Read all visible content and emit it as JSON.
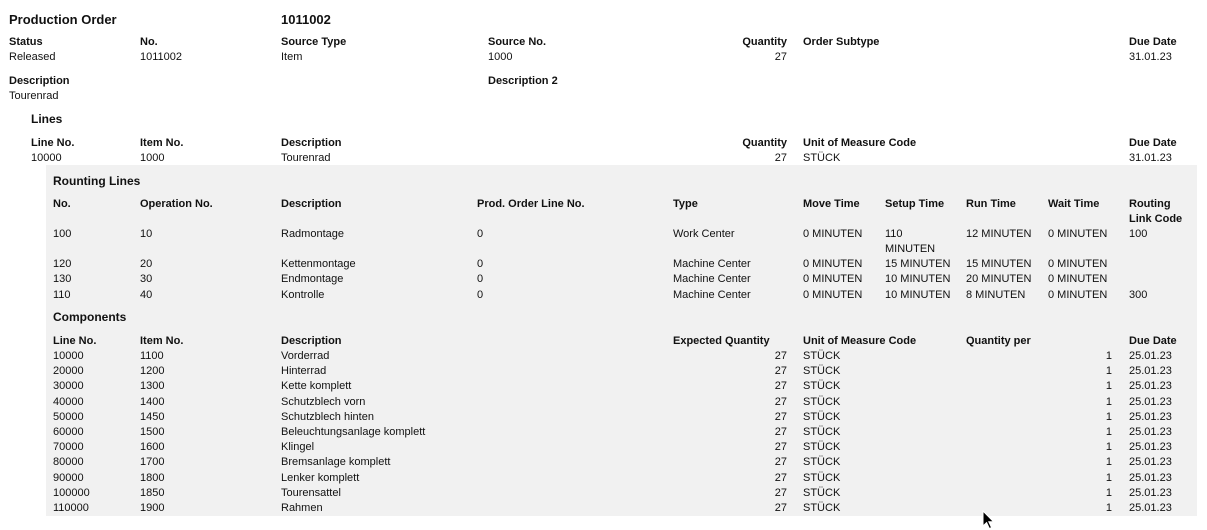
{
  "header": {
    "title": "Production Order",
    "number": "1011002",
    "fields": {
      "status": {
        "label": "Status",
        "value": "Released"
      },
      "no": {
        "label": "No.",
        "value": "1011002"
      },
      "source_type": {
        "label": "Source Type",
        "value": "Item"
      },
      "source_no": {
        "label": "Source No.",
        "value": "1000"
      },
      "quantity": {
        "label": "Quantity",
        "value": "27"
      },
      "order_subtype": {
        "label": "Order Subtype",
        "value": ""
      },
      "due_date": {
        "label": "Due Date",
        "value": "31.01.23"
      },
      "description": {
        "label": "Description",
        "value": "Tourenrad"
      },
      "description2": {
        "label": "Description 2",
        "value": ""
      }
    }
  },
  "lines": {
    "title": "Lines",
    "columns": {
      "line_no": "Line No.",
      "item_no": "Item No.",
      "description": "Description",
      "quantity": "Quantity",
      "uom": "Unit of Measure Code",
      "due_date": "Due Date"
    },
    "row": {
      "line_no": "10000",
      "item_no": "1000",
      "description": "Tourenrad",
      "quantity": "27",
      "uom": "STÜCK",
      "due_date": "31.01.23"
    }
  },
  "routing": {
    "title": "Rounting Lines",
    "columns": {
      "no": "No.",
      "operation_no": "Operation No.",
      "description": "Description",
      "prod_order_line_no": "Prod. Order Line No.",
      "type": "Type",
      "move_time": "Move Time",
      "setup_time": "Setup Time",
      "run_time": "Run Time",
      "wait_time": "Wait Time",
      "routing_link_code_1": "Routing",
      "routing_link_code_2": "Link Code"
    },
    "rows": [
      {
        "no": "100",
        "operation_no": "10",
        "description": "Radmontage",
        "prod_order_line_no": "0",
        "type": "Work Center",
        "move_time": "0 MINUTEN",
        "setup_time_1": "110",
        "setup_time_2": "MINUTEN",
        "run_time": "12 MINUTEN",
        "wait_time": "0 MINUTEN",
        "routing_link_code": "100"
      },
      {
        "no": "120",
        "operation_no": "20",
        "description": "Kettenmontage",
        "prod_order_line_no": "0",
        "type": "Machine Center",
        "move_time": "0 MINUTEN",
        "setup_time_1": "15 MINUTEN",
        "run_time": "15 MINUTEN",
        "wait_time": "0 MINUTEN",
        "routing_link_code": ""
      },
      {
        "no": "130",
        "operation_no": "30",
        "description": "Endmontage",
        "prod_order_line_no": "0",
        "type": "Machine Center",
        "move_time": "0 MINUTEN",
        "setup_time_1": "10 MINUTEN",
        "run_time": "20 MINUTEN",
        "wait_time": "0 MINUTEN",
        "routing_link_code": ""
      },
      {
        "no": "110",
        "operation_no": "40",
        "description": "Kontrolle",
        "prod_order_line_no": "0",
        "type": "Machine Center",
        "move_time": "0 MINUTEN",
        "setup_time_1": "10 MINUTEN",
        "run_time": "8 MINUTEN",
        "wait_time": "0 MINUTEN",
        "routing_link_code": "300"
      }
    ]
  },
  "components": {
    "title": "Components",
    "columns": {
      "line_no": "Line No.",
      "item_no": "Item No.",
      "description": "Description",
      "expected_quantity": "Expected Quantity",
      "uom": "Unit of Measure Code",
      "quantity_per": "Quantity per",
      "due_date": "Due Date"
    },
    "rows": [
      {
        "line_no": "10000",
        "item_no": "1100",
        "description": "Vorderrad",
        "expected_quantity": "27",
        "uom": "STÜCK",
        "quantity_per": "1",
        "due_date": "25.01.23"
      },
      {
        "line_no": "20000",
        "item_no": "1200",
        "description": "Hinterrad",
        "expected_quantity": "27",
        "uom": "STÜCK",
        "quantity_per": "1",
        "due_date": "25.01.23"
      },
      {
        "line_no": "30000",
        "item_no": "1300",
        "description": "Kette komplett",
        "expected_quantity": "27",
        "uom": "STÜCK",
        "quantity_per": "1",
        "due_date": "25.01.23"
      },
      {
        "line_no": "40000",
        "item_no": "1400",
        "description": "Schutzblech vorn",
        "expected_quantity": "27",
        "uom": "STÜCK",
        "quantity_per": "1",
        "due_date": "25.01.23"
      },
      {
        "line_no": "50000",
        "item_no": "1450",
        "description": "Schutzblech hinten",
        "expected_quantity": "27",
        "uom": "STÜCK",
        "quantity_per": "1",
        "due_date": "25.01.23"
      },
      {
        "line_no": "60000",
        "item_no": "1500",
        "description": "Beleuchtungsanlage komplett",
        "expected_quantity": "27",
        "uom": "STÜCK",
        "quantity_per": "1",
        "due_date": "25.01.23"
      },
      {
        "line_no": "70000",
        "item_no": "1600",
        "description": "Klingel",
        "expected_quantity": "27",
        "uom": "STÜCK",
        "quantity_per": "1",
        "due_date": "25.01.23"
      },
      {
        "line_no": "80000",
        "item_no": "1700",
        "description": "Bremsanlage komplett",
        "expected_quantity": "27",
        "uom": "STÜCK",
        "quantity_per": "1",
        "due_date": "25.01.23"
      },
      {
        "line_no": "90000",
        "item_no": "1800",
        "description": "Lenker komplett",
        "expected_quantity": "27",
        "uom": "STÜCK",
        "quantity_per": "1",
        "due_date": "25.01.23"
      },
      {
        "line_no": "100000",
        "item_no": "1850",
        "description": "Tourensattel",
        "expected_quantity": "27",
        "uom": "STÜCK",
        "quantity_per": "1",
        "due_date": "25.01.23"
      },
      {
        "line_no": "110000",
        "item_no": "1900",
        "description": "Rahmen",
        "expected_quantity": "27",
        "uom": "STÜCK",
        "quantity_per": "1",
        "due_date": "25.01.23"
      }
    ]
  },
  "cursor": {
    "icon": "mouse-pointer-icon"
  }
}
